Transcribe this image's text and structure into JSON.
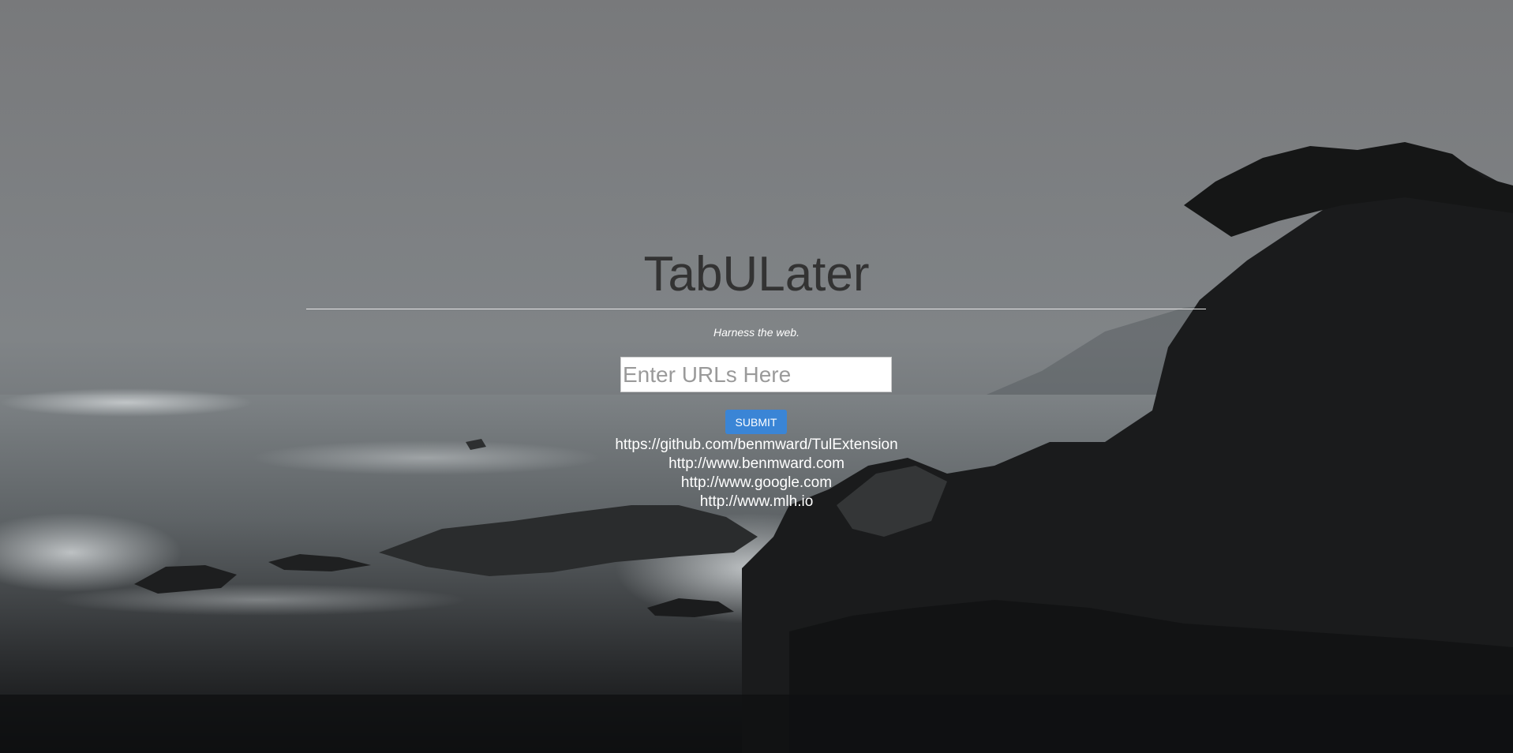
{
  "app": {
    "title": "TabULater",
    "tagline": "Harness the web."
  },
  "form": {
    "url_input": {
      "value": "",
      "placeholder": "Enter URLs Here"
    },
    "submit_label": "SUBMIT"
  },
  "urls": [
    "https://github.com/benmward/TulExtension",
    "http://www.benmward.com",
    "http://www.google.com",
    "http://www.mlh.io"
  ],
  "colors": {
    "title": "#333333",
    "submit_button": "#3a85d6",
    "text": "#ffffff"
  },
  "background": "foggy-coastline-photo"
}
